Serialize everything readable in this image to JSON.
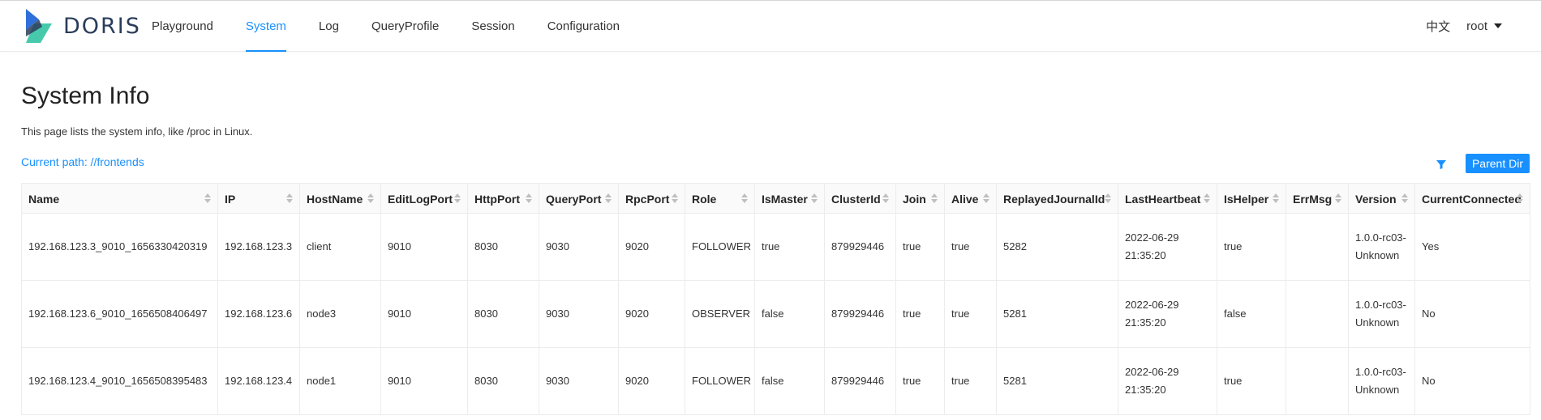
{
  "app": {
    "logo_text": "DORIS",
    "colors": {
      "accent": "#1890ff",
      "logo_dark": "#2b3c5a",
      "logo_blue": "#2f6fda",
      "logo_teal": "#3cc7a6"
    }
  },
  "nav": {
    "items": [
      {
        "label": "Playground"
      },
      {
        "label": "System"
      },
      {
        "label": "Log"
      },
      {
        "label": "QueryProfile"
      },
      {
        "label": "Session"
      },
      {
        "label": "Configuration"
      }
    ],
    "active": "System"
  },
  "header_right": {
    "lang": "中文",
    "user": "root"
  },
  "page": {
    "title": "System Info",
    "description": "This page lists the system info, like /proc in Linux.",
    "current_path": "Current path: //frontends",
    "parent_dir_label": "Parent Dir",
    "filter_icon": "filter-icon"
  },
  "table": {
    "columns": [
      "Name",
      "IP",
      "HostName",
      "EditLogPort",
      "HttpPort",
      "QueryPort",
      "RpcPort",
      "Role",
      "IsMaster",
      "ClusterId",
      "Join",
      "Alive",
      "ReplayedJournalId",
      "LastHeartbeat",
      "IsHelper",
      "ErrMsg",
      "Version",
      "CurrentConnected"
    ],
    "rows": [
      [
        "192.168.123.3_9010_1656330420319",
        "192.168.123.3",
        "client",
        "9010",
        "8030",
        "9030",
        "9020",
        "FOLLOWER",
        "true",
        "879929446",
        "true",
        "true",
        "5282",
        "2022-06-29 21:35:20",
        "true",
        "",
        "1.0.0-rc03-Unknown",
        "Yes"
      ],
      [
        "192.168.123.6_9010_1656508406497",
        "192.168.123.6",
        "node3",
        "9010",
        "8030",
        "9030",
        "9020",
        "OBSERVER",
        "false",
        "879929446",
        "true",
        "true",
        "5281",
        "2022-06-29 21:35:20",
        "false",
        "",
        "1.0.0-rc03-Unknown",
        "No"
      ],
      [
        "192.168.123.4_9010_1656508395483",
        "192.168.123.4",
        "node1",
        "9010",
        "8030",
        "9030",
        "9020",
        "FOLLOWER",
        "false",
        "879929446",
        "true",
        "true",
        "5281",
        "2022-06-29 21:35:20",
        "true",
        "",
        "1.0.0-rc03-Unknown",
        "No"
      ]
    ]
  }
}
